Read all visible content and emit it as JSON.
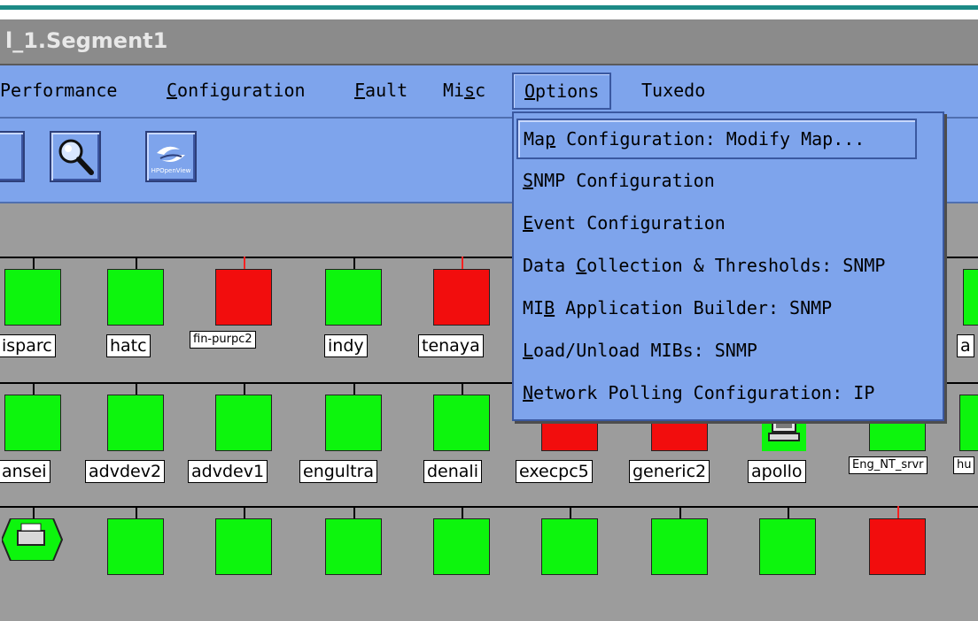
{
  "window": {
    "title": "l_1.Segment1"
  },
  "menubar": {
    "items": [
      {
        "id": "performance",
        "pre": "",
        "mn": "",
        "post": "Performance"
      },
      {
        "id": "configuration",
        "pre": "",
        "mn": "C",
        "post": "onfiguration"
      },
      {
        "id": "fault",
        "pre": "",
        "mn": "F",
        "post": "ault"
      },
      {
        "id": "misc",
        "pre": "Mi",
        "mn": "s",
        "post": "c"
      },
      {
        "id": "options",
        "pre": "",
        "mn": "O",
        "post": "ptions"
      },
      {
        "id": "tuxedo",
        "pre": "",
        "mn": "",
        "post": "Tuxedo"
      }
    ]
  },
  "toolbar": {
    "buttons": [
      {
        "id": "left-edge",
        "icon": "button-edge"
      },
      {
        "id": "find",
        "icon": "magnifier-icon"
      },
      {
        "id": "hp-openview",
        "icon": "hp-openview-icon",
        "caption": "HPOpenView"
      }
    ]
  },
  "options_menu": {
    "items": [
      {
        "pre": "Ma",
        "mn": "p",
        "post": " Configuration: Modify Map..."
      },
      {
        "pre": "",
        "mn": "S",
        "post": "NMP Configuration"
      },
      {
        "pre": "",
        "mn": "E",
        "post": "vent Configuration"
      },
      {
        "pre": "Data ",
        "mn": "C",
        "post": "ollection & Thresholds: SNMP"
      },
      {
        "pre": "MI",
        "mn": "B",
        "post": " Application Builder: SNMP"
      },
      {
        "pre": "",
        "mn": "L",
        "post": "oad/Unload MIBs: SNMP"
      },
      {
        "pre": "",
        "mn": "N",
        "post": "etwork Polling Configuration: IP"
      }
    ]
  },
  "map": {
    "rows": [
      {
        "nodes": [
          {
            "label": "isparc",
            "status": "green"
          },
          {
            "label": "hatc",
            "status": "green"
          },
          {
            "label": "fin-purpc2",
            "status": "red"
          },
          {
            "label": "indy",
            "status": "green"
          },
          {
            "label": "tenaya",
            "status": "red"
          },
          {
            "label": "a",
            "status": "green"
          }
        ]
      },
      {
        "nodes": [
          {
            "label": "ansei",
            "status": "green"
          },
          {
            "label": "advdev2",
            "status": "green"
          },
          {
            "label": "advdev1",
            "status": "green"
          },
          {
            "label": "engultra",
            "status": "green"
          },
          {
            "label": "denali",
            "status": "green"
          },
          {
            "label": "execpc5",
            "status": "red"
          },
          {
            "label": "generic2",
            "status": "red"
          },
          {
            "label": "apollo",
            "status": "computer"
          },
          {
            "label": "Eng_NT_srvr",
            "status": "green"
          },
          {
            "label": "hu",
            "status": "green"
          }
        ]
      },
      {
        "nodes": [
          {
            "label": "",
            "status": "printer"
          },
          {
            "label": "",
            "status": "green"
          },
          {
            "label": "",
            "status": "green"
          },
          {
            "label": "",
            "status": "green"
          },
          {
            "label": "",
            "status": "green"
          },
          {
            "label": "",
            "status": "green"
          },
          {
            "label": "",
            "status": "green"
          },
          {
            "label": "",
            "status": "green"
          },
          {
            "label": "",
            "status": "red"
          }
        ]
      }
    ]
  }
}
